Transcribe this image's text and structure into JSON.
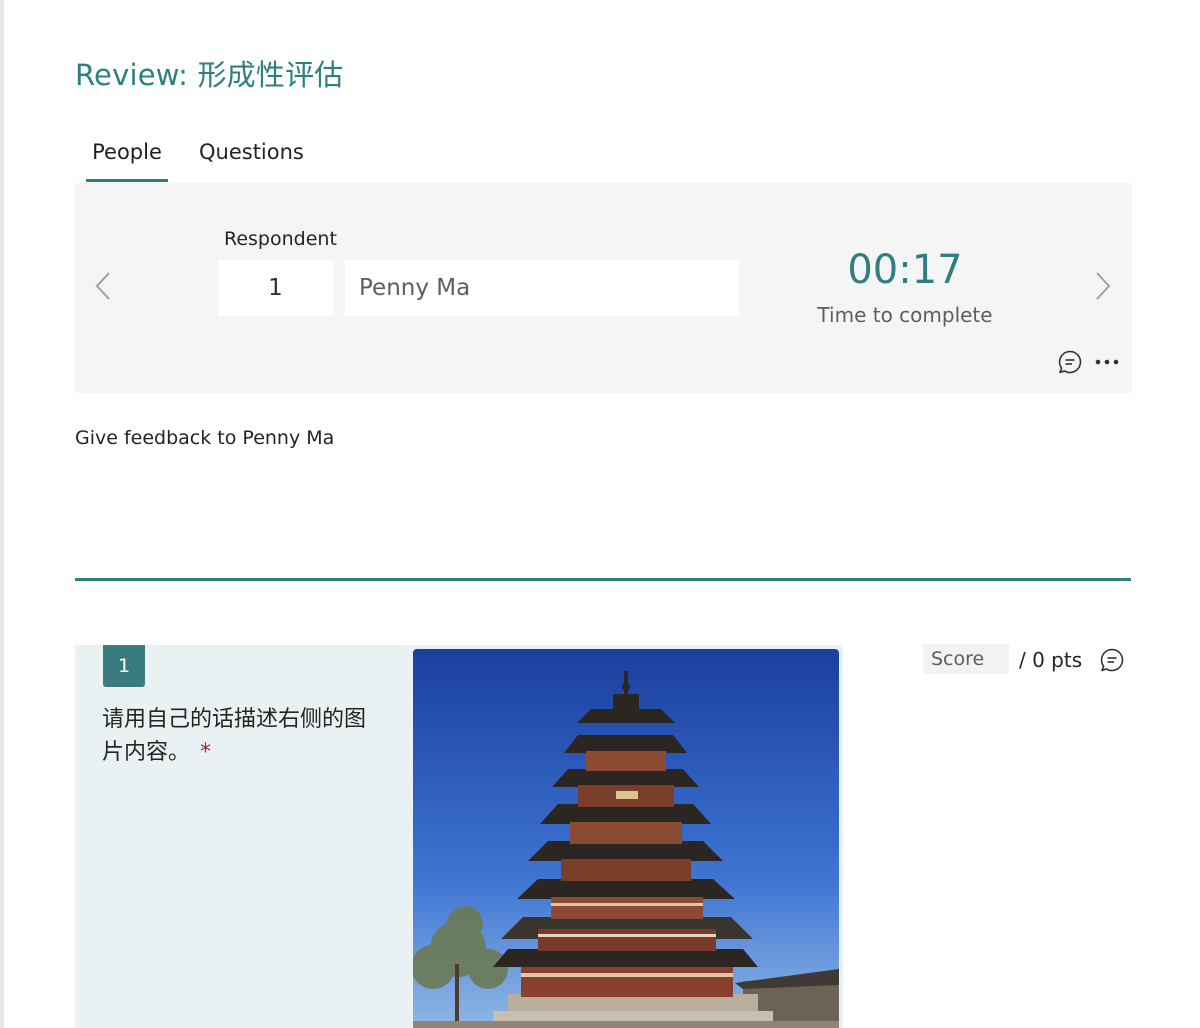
{
  "page": {
    "title": "Review: 形成性评估"
  },
  "tabs": [
    {
      "label": "People",
      "selected": true
    },
    {
      "label": "Questions",
      "selected": false
    }
  ],
  "respondent": {
    "label": "Respondent",
    "number": "1",
    "name": "Penny Ma",
    "time_value": "00:17",
    "time_label": "Time to complete"
  },
  "feedback": {
    "label": "Give feedback to Penny Ma",
    "value": ""
  },
  "question": {
    "number": "1",
    "text": "请用自己的话描述右侧的图片内容。",
    "required_mark": "*",
    "image_icon": "pagoda-photo"
  },
  "score": {
    "placeholder": "Score",
    "pts_label": "/ 0 pts"
  },
  "icons": {
    "prev": "chevron-left-icon",
    "next": "chevron-right-icon",
    "comment": "comment-icon",
    "more": "more-ellipsis-icon"
  },
  "colors": {
    "accent": "#2f7f82",
    "question_badge": "#3a7c7e",
    "question_card_bg": "#e9f1f2",
    "panel_bg": "#f5f5f5",
    "required": "#a4262c"
  }
}
